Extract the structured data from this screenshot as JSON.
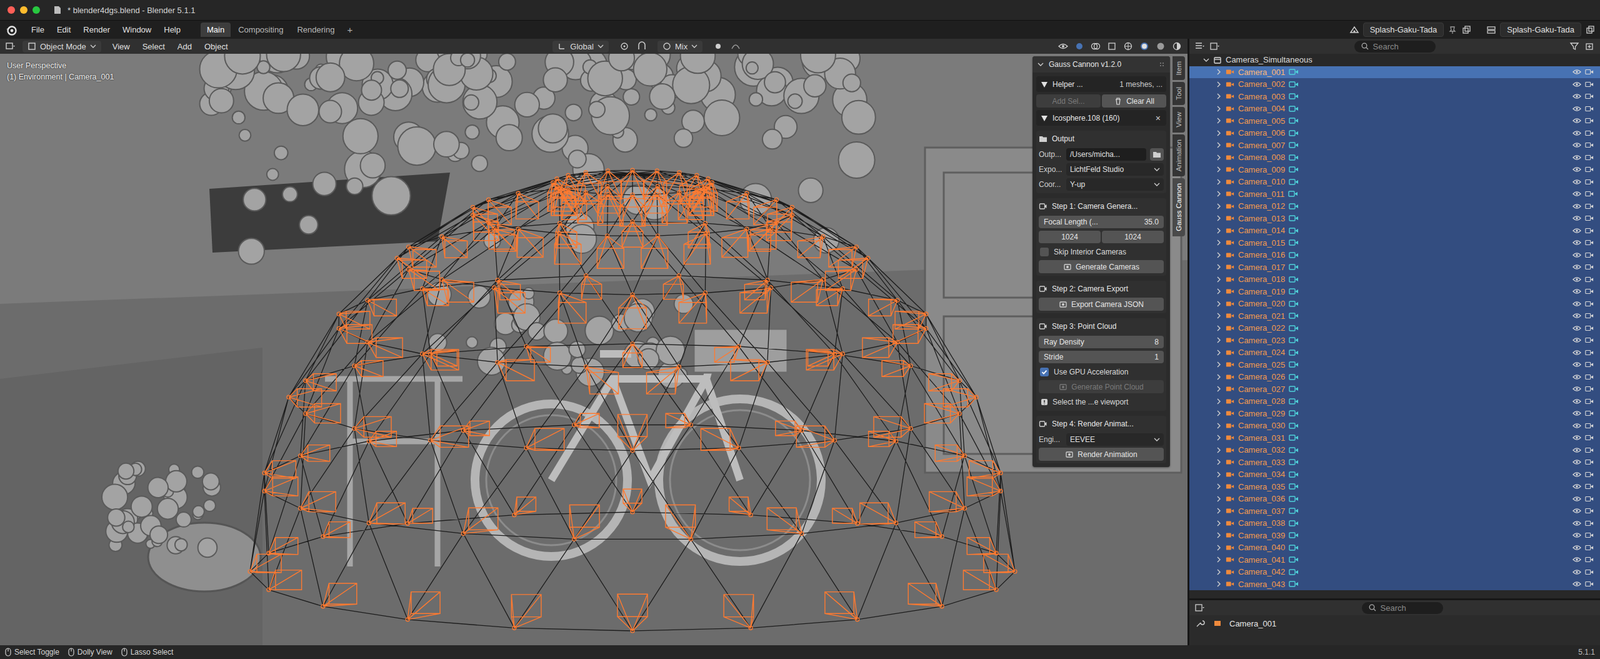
{
  "window": {
    "title": "* blender4dgs.blend - Blender 5.1.1"
  },
  "menu": [
    "File",
    "Edit",
    "Render",
    "Window",
    "Help"
  ],
  "workspaces": [
    {
      "label": "Main",
      "selected": true
    },
    {
      "label": "Compositing",
      "selected": false
    },
    {
      "label": "Rendering",
      "selected": false
    }
  ],
  "workspace_add": "+",
  "scene": "Splash-Gaku-Tada",
  "view_layer": "Splash-Gaku-Tada",
  "viewport": {
    "mode": "Object Mode",
    "menus": [
      "View",
      "Select",
      "Add",
      "Object"
    ],
    "orientation": "Global",
    "pivot_blend": "Mix",
    "overlay_lines": [
      "User Perspective",
      "(1) Environment | Camera_001"
    ]
  },
  "side_tabs": [
    {
      "label": "Item",
      "selected": false
    },
    {
      "label": "Tool",
      "selected": false
    },
    {
      "label": "View",
      "selected": false
    },
    {
      "label": "Animation",
      "selected": false
    },
    {
      "label": "Gauss Cannon",
      "selected": true
    }
  ],
  "addon": {
    "title": "Gauss Cannon v1.2.0",
    "helper": {
      "label": "Helper ...",
      "value": "1 meshes, ..."
    },
    "add_selected": {
      "label": "Add Sel...",
      "disabled": true
    },
    "clear_all": "Clear All",
    "mesh": {
      "label": "Icosphere.108 (160)",
      "remove": "×"
    },
    "output": {
      "title": "Output",
      "fields": [
        {
          "label": "Outp...",
          "value": "/Users/micha...",
          "kind": "path"
        },
        {
          "label": "Expo...",
          "value": "LichtFeld Studio",
          "kind": "dropdown"
        },
        {
          "label": "Coor...",
          "value": "Y-up",
          "kind": "dropdown"
        }
      ]
    },
    "steps": [
      {
        "title": "Step 1: Camera Genera...",
        "items": [
          {
            "kind": "number",
            "label": "Focal Length (...",
            "value": "35.0"
          },
          {
            "kind": "pair",
            "values": [
              "1024",
              "1024"
            ]
          },
          {
            "kind": "checkbox",
            "label": "Skip Interior Cameras",
            "checked": false
          },
          {
            "kind": "button",
            "label": "Generate Cameras",
            "disabled": false
          }
        ]
      },
      {
        "title": "Step 2: Camera Export",
        "items": [
          {
            "kind": "button",
            "label": "Export Camera JSON",
            "disabled": false
          }
        ]
      },
      {
        "title": "Step 3: Point Cloud",
        "items": [
          {
            "kind": "number",
            "label": "Ray Density",
            "value": "8"
          },
          {
            "kind": "number",
            "label": "Stride",
            "value": "1"
          },
          {
            "kind": "checkbox",
            "label": "Use GPU Acceleration",
            "checked": true
          },
          {
            "kind": "button",
            "label": "Generate Point Cloud",
            "disabled": true
          },
          {
            "kind": "note",
            "label": "Select the ...e viewport"
          }
        ]
      },
      {
        "title": "Step 4: Render Animat...",
        "items": [
          {
            "kind": "dropdown",
            "label": "Engi...",
            "value": "EEVEE"
          },
          {
            "kind": "button",
            "label": "Render Animation",
            "disabled": false
          }
        ]
      }
    ]
  },
  "outliner": {
    "search_placeholder": "Search",
    "collection": "Cameras_Simultaneous",
    "rows": [
      {
        "name": "Camera_001",
        "selected": true,
        "active": true,
        "visible": true
      },
      {
        "name": "Camera_002",
        "selected": true,
        "active": false,
        "visible": true
      },
      {
        "name": "Camera_003",
        "selected": true,
        "active": false,
        "visible": true
      },
      {
        "name": "Camera_004",
        "selected": true,
        "active": false,
        "visible": true
      },
      {
        "name": "Camera_005",
        "selected": true,
        "active": false,
        "visible": true
      },
      {
        "name": "Camera_006",
        "selected": true,
        "active": false,
        "visible": true
      },
      {
        "name": "Camera_007",
        "selected": true,
        "active": false,
        "visible": true
      },
      {
        "name": "Camera_008",
        "selected": true,
        "active": false,
        "visible": true
      },
      {
        "name": "Camera_009",
        "selected": true,
        "active": false,
        "visible": true
      },
      {
        "name": "Camera_010",
        "selected": true,
        "active": false,
        "visible": true
      },
      {
        "name": "Camera_011",
        "selected": true,
        "active": false,
        "visible": true
      },
      {
        "name": "Camera_012",
        "selected": true,
        "active": false,
        "visible": true
      },
      {
        "name": "Camera_013",
        "selected": true,
        "active": false,
        "visible": true
      },
      {
        "name": "Camera_014",
        "selected": true,
        "active": false,
        "visible": true
      },
      {
        "name": "Camera_015",
        "selected": true,
        "active": false,
        "visible": true
      },
      {
        "name": "Camera_016",
        "selected": true,
        "active": false,
        "visible": true
      },
      {
        "name": "Camera_017",
        "selected": true,
        "active": false,
        "visible": true
      },
      {
        "name": "Camera_018",
        "selected": true,
        "active": false,
        "visible": true
      },
      {
        "name": "Camera_019",
        "selected": true,
        "active": false,
        "visible": true
      },
      {
        "name": "Camera_020",
        "selected": true,
        "active": false,
        "visible": true
      },
      {
        "name": "Camera_021",
        "selected": true,
        "active": false,
        "visible": true
      },
      {
        "name": "Camera_022",
        "selected": true,
        "active": false,
        "visible": true
      },
      {
        "name": "Camera_023",
        "selected": true,
        "active": false,
        "visible": true
      },
      {
        "name": "Camera_024",
        "selected": true,
        "active": false,
        "visible": true
      },
      {
        "name": "Camera_025",
        "selected": true,
        "active": false,
        "visible": true
      },
      {
        "name": "Camera_026",
        "selected": true,
        "active": false,
        "visible": true
      },
      {
        "name": "Camera_027",
        "selected": true,
        "active": false,
        "visible": true
      },
      {
        "name": "Camera_028",
        "selected": true,
        "active": false,
        "visible": true
      },
      {
        "name": "Camera_029",
        "selected": true,
        "active": false,
        "visible": true
      },
      {
        "name": "Camera_030",
        "selected": true,
        "active": false,
        "visible": true
      },
      {
        "name": "Camera_031",
        "selected": true,
        "active": false,
        "visible": true
      },
      {
        "name": "Camera_032",
        "selected": true,
        "active": false,
        "visible": true
      },
      {
        "name": "Camera_033",
        "selected": true,
        "active": false,
        "visible": true
      },
      {
        "name": "Camera_034",
        "selected": true,
        "active": false,
        "visible": true
      },
      {
        "name": "Camera_035",
        "selected": true,
        "active": false,
        "visible": true
      },
      {
        "name": "Camera_036",
        "selected": true,
        "active": false,
        "visible": true
      },
      {
        "name": "Camera_037",
        "selected": true,
        "active": false,
        "visible": true
      },
      {
        "name": "Camera_038",
        "selected": true,
        "active": false,
        "visible": true
      },
      {
        "name": "Camera_039",
        "selected": true,
        "active": false,
        "visible": true
      },
      {
        "name": "Camera_040",
        "selected": true,
        "active": false,
        "visible": true
      },
      {
        "name": "Camera_041",
        "selected": true,
        "active": false,
        "visible": true
      },
      {
        "name": "Camera_042",
        "selected": true,
        "active": false,
        "visible": true
      },
      {
        "name": "Camera_043",
        "selected": true,
        "active": false,
        "visible": true
      }
    ]
  },
  "properties": {
    "search_placeholder": "Search",
    "object": "Camera_001"
  },
  "status_bar": {
    "hints": [
      "Select Toggle",
      "Dolly View",
      "Lasso Select"
    ],
    "version": "5.1.1"
  }
}
